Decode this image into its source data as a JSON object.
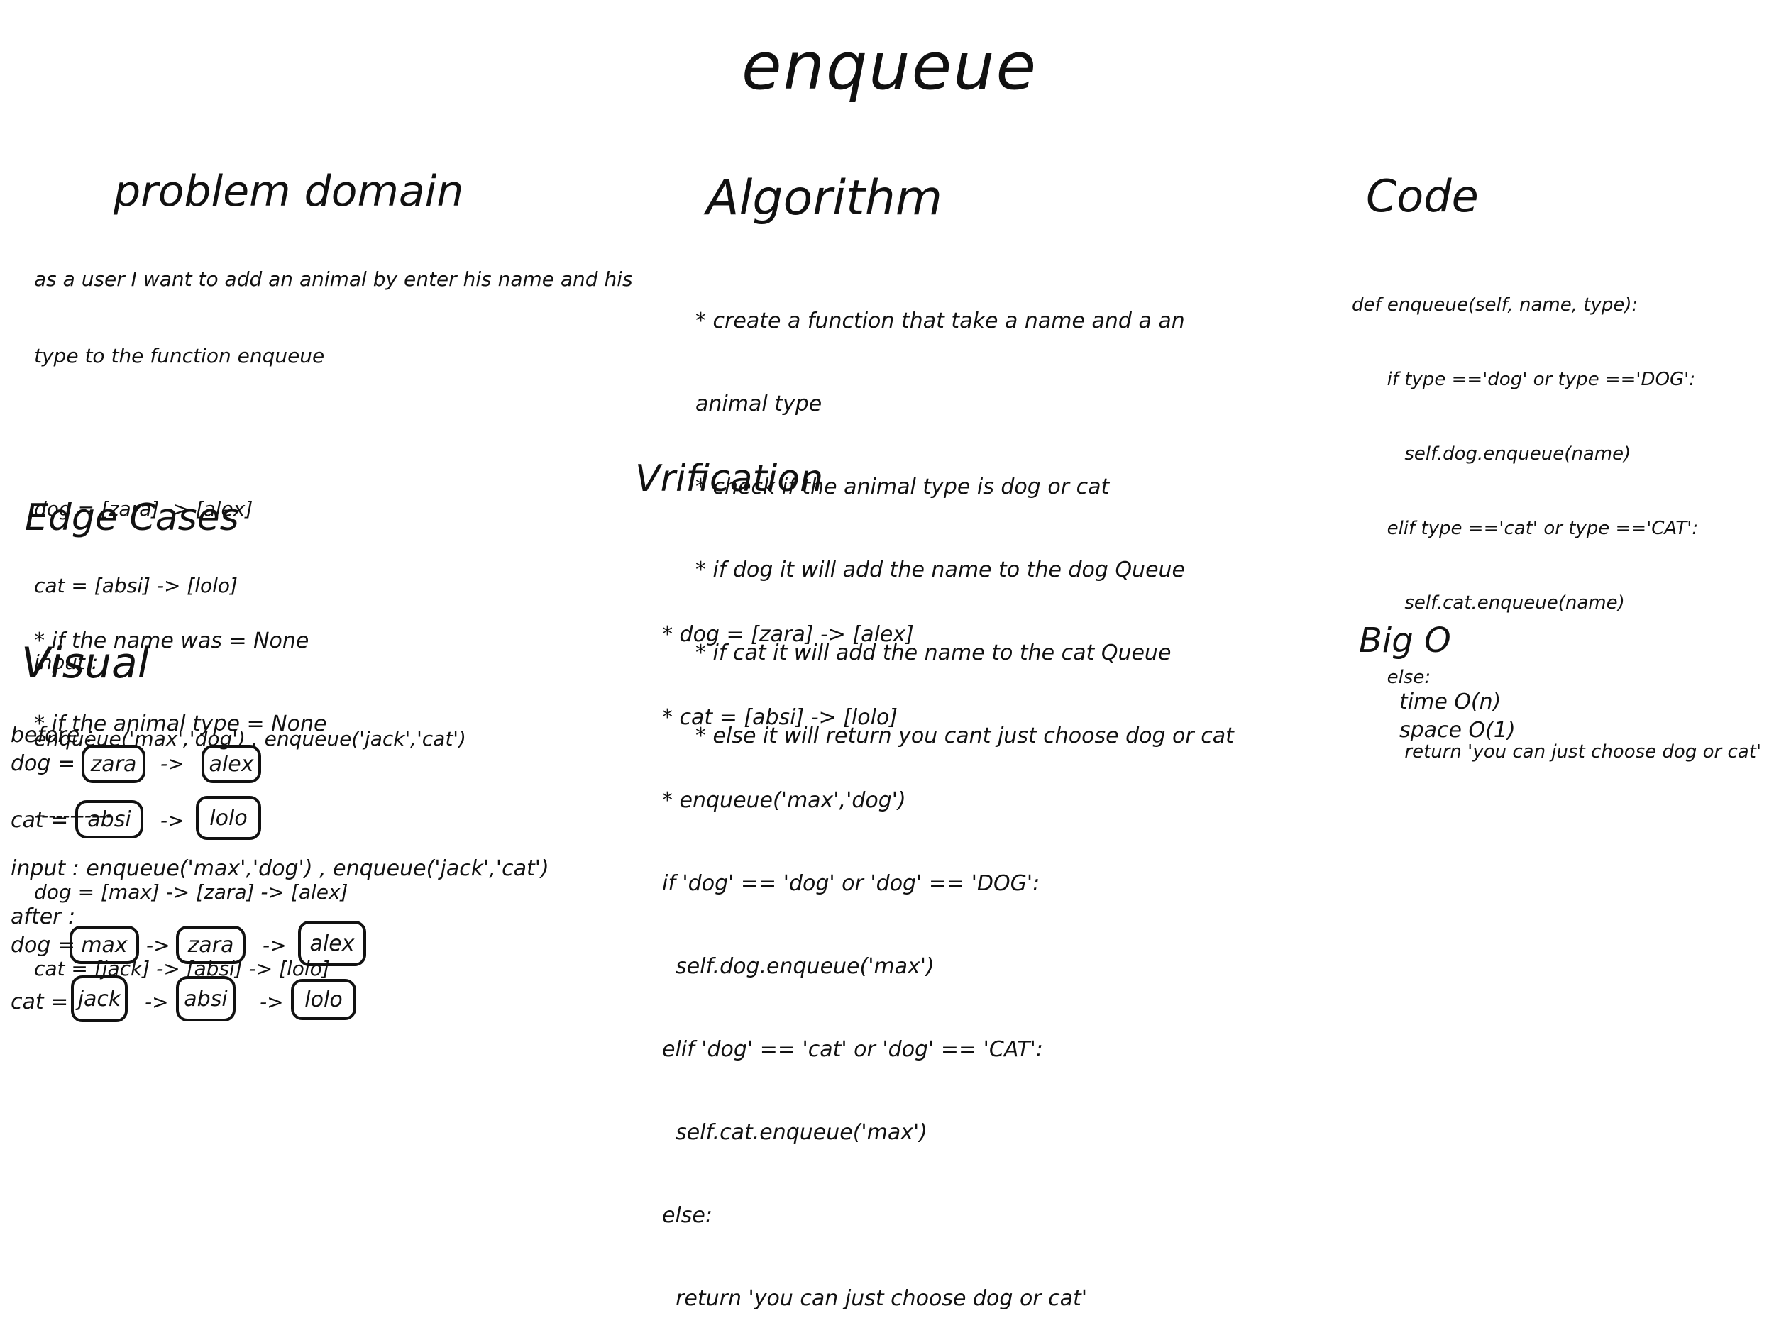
{
  "title": "enqueue",
  "problem_domain": {
    "heading": "problem domain",
    "lines": [
      "as a user I want to add an animal by enter his name and his",
      "type to the function enqueue",
      "",
      "dog = [zara] -> [alex]",
      "cat = [absi] -> [lolo]",
      "input :",
      "enqueue('max','dog') , enqueue('jack','cat')",
      "-----------",
      "dog = [max] -> [zara] -> [alex]",
      "cat = [jack] -> [absi] -> [lolo]"
    ]
  },
  "edge_cases": {
    "heading": "Edge Cases",
    "lines": [
      "* if the name was = None",
      "* if the animal type = None"
    ]
  },
  "visual": {
    "heading": "Visual",
    "before_label": "before :",
    "dog_label": "dog =",
    "cat_label": "cat =",
    "arrow": "->",
    "before_dog": [
      "zara",
      "alex"
    ],
    "before_cat": [
      "absi",
      "lolo"
    ],
    "input_line": "input : enqueue('max','dog') , enqueue('jack','cat')",
    "after_label": "after :",
    "after_dog": [
      "max",
      "zara",
      "alex"
    ],
    "after_cat": [
      "jack",
      "absi",
      "lolo"
    ]
  },
  "algorithm": {
    "heading": "Algorithm",
    "lines": [
      "* create a function that take a name and a an",
      "animal type",
      "* check if the animal type is dog or cat",
      "* if dog it will add the name to the dog Queue",
      "* if cat it will add the name to the cat Queue",
      "* else it will return you cant just choose dog or cat"
    ]
  },
  "verification": {
    "heading": "Vrification",
    "lines": [
      "* dog = [zara] -> [alex]",
      "* cat = [absi] -> [lolo]",
      "* enqueue('max','dog')",
      "if 'dog' == 'dog' or 'dog' == 'DOG':",
      "  self.dog.enqueue('max')",
      "elif 'dog' == 'cat' or 'dog' == 'CAT':",
      "  self.cat.enqueue('max')",
      "else:",
      "  return 'you can just choose dog or cat'"
    ]
  },
  "code": {
    "heading": "Code",
    "lines": [
      "def enqueue(self, name, type):",
      "      if type =='dog' or type =='DOG':",
      "         self.dog.enqueue(name)",
      "      elif type =='cat' or type =='CAT':",
      "         self.cat.enqueue(name)",
      "      else:",
      "         return 'you can just choose dog or cat'"
    ]
  },
  "big_o": {
    "heading": "Big O",
    "time": "time O(n)",
    "space": "space O(1)"
  }
}
